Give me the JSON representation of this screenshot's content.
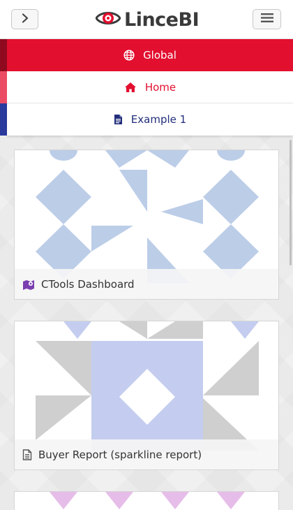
{
  "header": {
    "logo_text": "LinceBI",
    "left_button_icon": "chevron-right-icon",
    "right_button_icon": "hamburger-menu-icon"
  },
  "menu": {
    "items": [
      {
        "label": "Global",
        "icon": "globe-icon"
      },
      {
        "label": "Home",
        "icon": "home-icon"
      },
      {
        "label": "Example 1",
        "icon": "document-icon"
      }
    ]
  },
  "cards": [
    {
      "label": "CTools Dashboard",
      "icon": "map-marker-icon"
    },
    {
      "label": "Buyer Report (sparkline report)",
      "icon": "report-icon"
    },
    {
      "label": "",
      "icon": "thumbnail"
    }
  ],
  "colors": {
    "accent_red": "#e20f2f",
    "dark_red": "#8f0a1f",
    "pink": "#ec4c63",
    "navy": "#222e7a",
    "thumb_blue": "#bccde8",
    "thumb_lavender": "#c4cdef",
    "thumb_gray": "#cfcfcf",
    "thumb_pink": "#e6bde9"
  }
}
